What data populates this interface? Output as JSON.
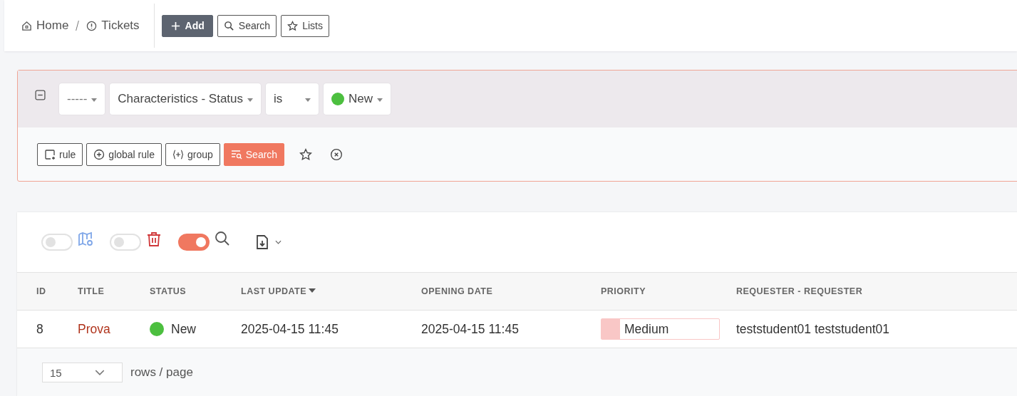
{
  "breadcrumb": [
    {
      "label": "Home"
    },
    {
      "label": "Tickets"
    }
  ],
  "header_buttons": [
    {
      "label": "Add",
      "primary": true
    },
    {
      "label": "Search",
      "primary": false
    },
    {
      "label": "Lists",
      "primary": false
    }
  ],
  "filter": {
    "expanded": true,
    "criteria": [
      {
        "value": "-----"
      },
      {
        "value": "Characteristics - Status"
      },
      {
        "value": "is"
      },
      {
        "value": "New",
        "color": "#4cbf3f"
      }
    ],
    "actions": [
      {
        "label": "rule",
        "primary": false
      },
      {
        "label": "global rule",
        "primary": false
      },
      {
        "label": "group",
        "primary": false
      },
      {
        "label": "Search",
        "primary": true
      }
    ]
  },
  "toolbar": [
    {
      "kind": "toggle",
      "on": false
    },
    {
      "kind": "toggle",
      "on": false
    },
    {
      "kind": "toggle",
      "on": true
    },
    {
      "kind": "export"
    }
  ],
  "table": {
    "columns": [
      {
        "label": "ID",
        "sorted": false
      },
      {
        "label": "TITLE",
        "sorted": false
      },
      {
        "label": "STATUS",
        "sorted": false
      },
      {
        "label": "LAST UPDATE",
        "sorted": true
      },
      {
        "label": "OPENING DATE",
        "sorted": false
      },
      {
        "label": "PRIORITY",
        "sorted": false
      },
      {
        "label": "REQUESTER - REQUESTER",
        "sorted": false
      }
    ],
    "rows": [
      {
        "id": "8",
        "title": "Prova",
        "status": {
          "label": "New",
          "color": "#4cbf3f"
        },
        "last_update": "2025-04-15 11:45",
        "opening_date": "2025-04-15 11:45",
        "priority": {
          "label": "Medium",
          "color": "#f9c7c6"
        },
        "requester": "teststudent01 teststudent01"
      }
    ]
  },
  "pagination": {
    "page_size": "15",
    "label": "rows / page"
  }
}
